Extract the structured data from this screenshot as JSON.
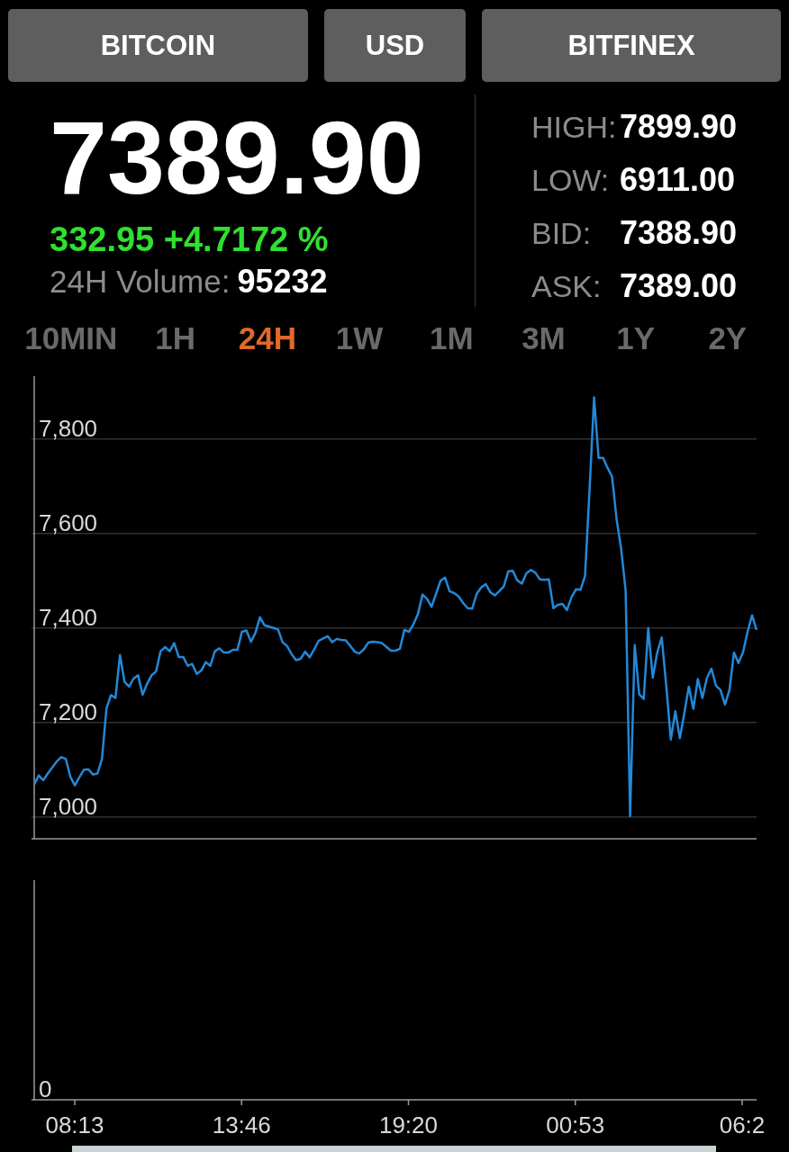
{
  "selectors": [
    {
      "label": "BITCOIN"
    },
    {
      "label": "USD"
    },
    {
      "label": "BITFINEX"
    }
  ],
  "ticker": {
    "price": "7389.90",
    "change": "332.95 +4.7172 %",
    "volume_label": "24H Volume:",
    "volume": "95232"
  },
  "stats": [
    {
      "label": "HIGH:",
      "value": "7899.90"
    },
    {
      "label": "LOW:",
      "value": "6911.00"
    },
    {
      "label": "BID:",
      "value": "7388.90"
    },
    {
      "label": "ASK:",
      "value": "7389.00"
    }
  ],
  "ranges": [
    {
      "label": "10MIN",
      "selected": false
    },
    {
      "label": "1H",
      "selected": false
    },
    {
      "label": "24H",
      "selected": true
    },
    {
      "label": "1W",
      "selected": false
    },
    {
      "label": "1M",
      "selected": false
    },
    {
      "label": "3M",
      "selected": false
    },
    {
      "label": "1Y",
      "selected": false
    },
    {
      "label": "2Y",
      "selected": false
    }
  ],
  "price_chart": {
    "chart_data": {
      "type": "line",
      "grid": true,
      "ylim": [
        6954,
        7933
      ],
      "yticks": [
        {
          "value": 7000,
          "label": "7,000"
        },
        {
          "value": 7200,
          "label": "7,200"
        },
        {
          "value": 7400,
          "label": "7,400"
        },
        {
          "value": 7600,
          "label": "7,600"
        },
        {
          "value": 7800,
          "label": "7,800"
        }
      ],
      "categories": [
        null,
        null,
        null,
        null,
        null,
        null,
        null,
        null,
        null,
        null,
        null,
        null,
        null,
        null,
        null,
        null,
        null,
        null,
        null,
        null,
        null,
        null,
        null,
        null,
        null,
        null,
        null,
        null,
        null,
        null,
        null,
        null,
        null,
        null,
        null,
        null,
        null,
        null,
        null,
        null,
        null,
        null,
        null,
        null,
        null,
        null,
        null,
        null,
        null,
        null,
        null,
        null,
        null,
        null,
        null,
        null,
        null,
        null,
        null,
        null,
        null,
        null,
        null,
        null,
        null,
        null,
        null,
        null,
        null,
        null,
        null,
        null,
        null,
        null,
        null,
        null,
        null,
        null,
        null,
        null,
        null,
        null,
        null,
        null,
        null,
        null,
        null,
        null,
        null,
        null,
        null,
        null,
        null,
        null,
        null,
        null,
        null,
        null,
        null,
        null,
        null,
        null,
        null,
        null,
        null,
        null,
        null,
        null,
        null,
        null,
        null,
        null,
        null,
        null,
        null,
        null,
        null,
        null,
        null,
        null,
        null,
        null,
        null,
        null,
        null,
        null,
        null,
        null,
        null,
        null,
        null,
        null,
        null,
        null,
        null,
        null,
        null,
        null,
        null,
        null,
        null,
        null,
        null,
        null,
        null,
        null,
        null,
        null,
        null,
        null,
        null,
        null,
        null,
        null,
        null,
        null,
        null,
        null,
        null,
        null,
        null
      ],
      "series": [
        {
          "color": "#2388d8",
          "values": [
            7069,
            7088,
            7078,
            7092,
            7105,
            7118,
            7127,
            7123,
            7085,
            7067,
            7084,
            7100,
            7101,
            7090,
            7092,
            7123,
            7230,
            7258,
            7252,
            7343,
            7286,
            7276,
            7293,
            7300,
            7259,
            7282,
            7300,
            7308,
            7351,
            7360,
            7351,
            7368,
            7339,
            7339,
            7320,
            7324,
            7303,
            7310,
            7328,
            7320,
            7351,
            7357,
            7348,
            7348,
            7354,
            7354,
            7392,
            7395,
            7371,
            7390,
            7423,
            7406,
            7403,
            7400,
            7397,
            7370,
            7362,
            7345,
            7332,
            7335,
            7350,
            7338,
            7355,
            7373,
            7378,
            7383,
            7370,
            7377,
            7375,
            7374,
            7362,
            7350,
            7346,
            7355,
            7369,
            7371,
            7370,
            7368,
            7360,
            7352,
            7352,
            7356,
            7396,
            7392,
            7408,
            7430,
            7471,
            7462,
            7445,
            7472,
            7500,
            7507,
            7478,
            7474,
            7467,
            7453,
            7442,
            7441,
            7472,
            7486,
            7493,
            7476,
            7469,
            7478,
            7488,
            7520,
            7521,
            7501,
            7494,
            7516,
            7523,
            7517,
            7503,
            7502,
            7503,
            7442,
            7449,
            7451,
            7438,
            7465,
            7482,
            7481,
            7510,
            7690,
            7888,
            7760,
            7760,
            7739,
            7720,
            7630,
            7568,
            7480,
            7002,
            7364,
            7260,
            7250,
            7400,
            7295,
            7348,
            7380,
            7276,
            7164,
            7224,
            7167,
            7220,
            7276,
            7229,
            7292,
            7252,
            7295,
            7314,
            7278,
            7269,
            7238,
            7269,
            7348,
            7326,
            7349,
            7392,
            7427,
            7396
          ]
        }
      ]
    }
  },
  "volume_chart": {
    "y_tick": "0",
    "x_ticks": [
      "08:13",
      "13:46",
      "19:20",
      "00:53",
      "06:2"
    ]
  }
}
